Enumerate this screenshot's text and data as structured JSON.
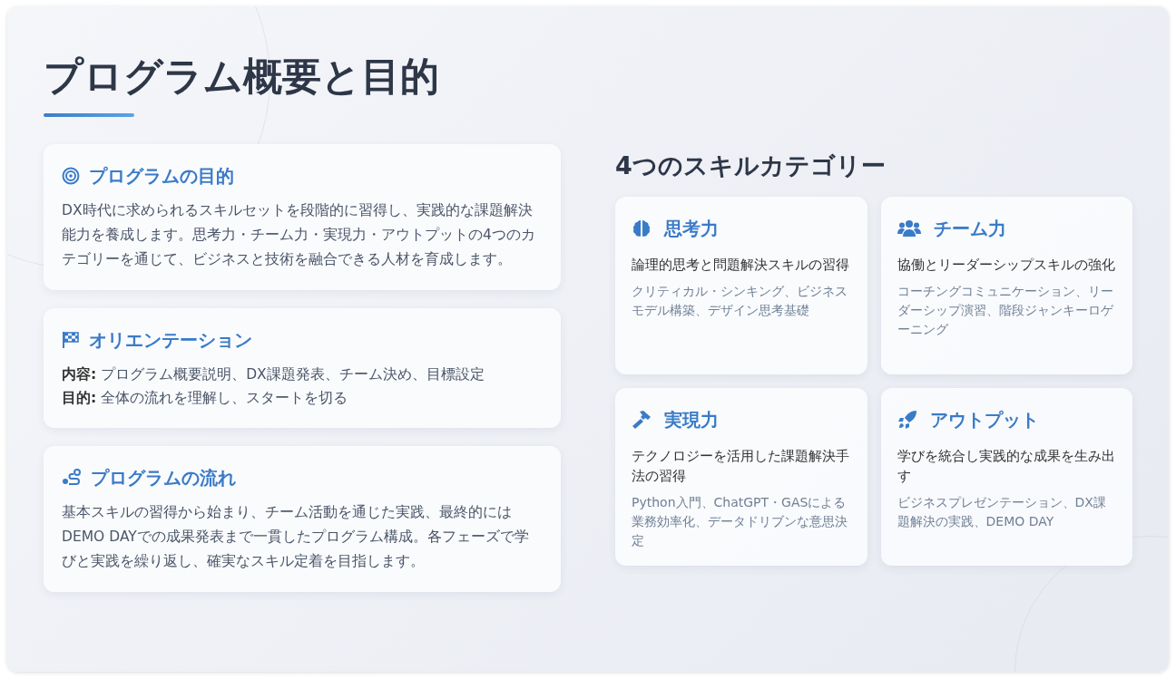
{
  "title": "プログラム概要と目的",
  "left_cards": [
    {
      "kind": "paragraph",
      "heading": "プログラムの目的",
      "text": "DX時代に求められるスキルセットを段階的に習得し、実践的な課題解決能力を養成します。思考力・チーム力・実現力・アウトプットの4つのカテゴリーを通じて、ビジネスと技術を融合できる人材を育成します。"
    },
    {
      "kind": "lines",
      "heading": "オリエンテーション",
      "lines": [
        "**内容:** プログラム概要説明、DX課題発表、チーム決め、目標設定",
        "**目的:** 全体の流れを理解し、スタートを切る"
      ]
    },
    {
      "kind": "paragraph",
      "heading": "プログラムの流れ",
      "text": "基本スキルの習得から始まり、チーム活動を通じた実践、最終的にはDEMO DAYでの成果発表まで一貫したプログラム構成。各フェーズで学びと実践を繰り返し、確実なスキル定着を目指します。"
    }
  ],
  "skills_heading": "4つのスキルカテゴリー",
  "skills": [
    {
      "name": "思考力",
      "description": "論理的思考と問題解決スキルの習得",
      "details": "クリティカル・シンキング、ビジネスモデル構築、デザイン思考基礎"
    },
    {
      "name": "チーム力",
      "description": "協働とリーダーシップスキルの強化",
      "details": "コーチングコミュニケーション、リーダーシップ演習、階段ジャンキーロゲーニング"
    },
    {
      "name": "実現力",
      "description": "テクノロジーを活用した課題解決手法の習得",
      "details": "Python入門、ChatGPT・GASによる業務効率化、データドリブンな意思決定"
    },
    {
      "name": "アウトプット",
      "description": "学びを統合し実践的な成果を生み出す",
      "details": "ビジネスプレゼンテーション、DX課題解決の実践、DEMO DAY"
    }
  ]
}
